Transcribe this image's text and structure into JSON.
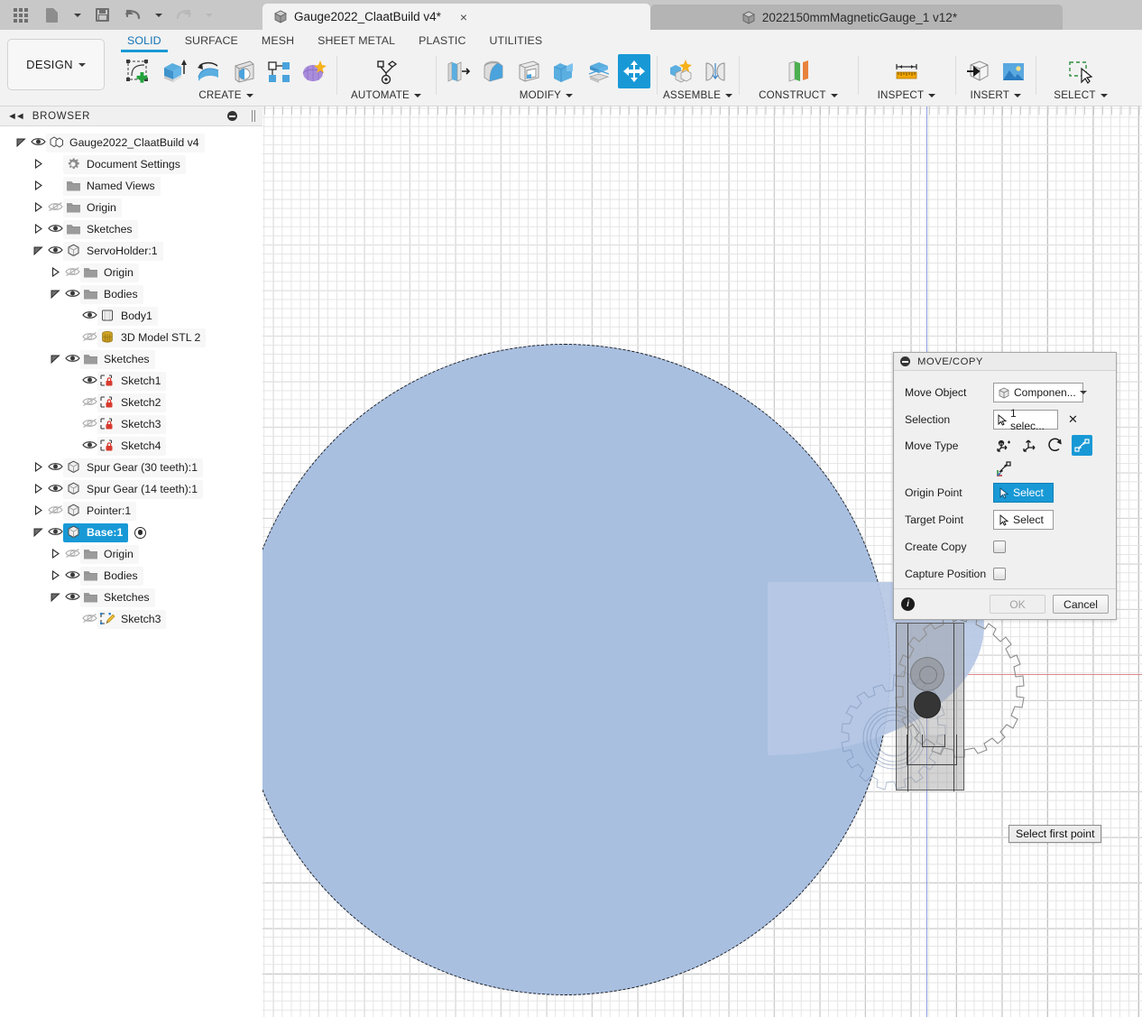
{
  "titlebar": {
    "icons": [
      "apps-grid-icon",
      "new-document-icon",
      "save-icon",
      "undo-icon",
      "redo-icon"
    ],
    "tabs": [
      {
        "label": "Gauge2022_ClaatBuild v4*",
        "active": true,
        "close": "×"
      },
      {
        "label": "2022150mmMagneticGauge_1 v12*",
        "active": false,
        "close": ""
      }
    ]
  },
  "ribbon": {
    "design_label": "DESIGN",
    "workspace_tabs": [
      {
        "label": "SOLID",
        "active": true
      },
      {
        "label": "SURFACE",
        "active": false
      },
      {
        "label": "MESH",
        "active": false
      },
      {
        "label": "SHEET METAL",
        "active": false
      },
      {
        "label": "PLASTIC",
        "active": false
      },
      {
        "label": "UTILITIES",
        "active": false
      }
    ],
    "groups": [
      {
        "name": "CREATE",
        "label": "CREATE",
        "dropdown": true
      },
      {
        "name": "AUTOMATE",
        "label": "AUTOMATE",
        "dropdown": true
      },
      {
        "name": "MODIFY",
        "label": "MODIFY",
        "dropdown": true
      },
      {
        "name": "ASSEMBLE",
        "label": "ASSEMBLE",
        "dropdown": true
      },
      {
        "name": "CONSTRUCT",
        "label": "CONSTRUCT",
        "dropdown": true
      },
      {
        "name": "INSPECT",
        "label": "INSPECT",
        "dropdown": true
      },
      {
        "name": "INSERT",
        "label": "INSERT",
        "dropdown": true
      },
      {
        "name": "SELECT",
        "label": "SELECT",
        "dropdown": true
      }
    ]
  },
  "browser": {
    "title": "BROWSER",
    "collapse_icon": "double-chevron-left-icon",
    "options_icon": "minus-circle-icon",
    "nodes": [
      {
        "label": "Gauge2022_ClaatBuild v4",
        "indent": 0,
        "twisty": "down",
        "eye": "visible",
        "icon": "assembly-icon",
        "selected": false
      },
      {
        "label": "Document Settings",
        "indent": 1,
        "twisty": "right",
        "eye": "none",
        "icon": "gear-icon",
        "selected": false
      },
      {
        "label": "Named Views",
        "indent": 1,
        "twisty": "right",
        "eye": "none",
        "icon": "folder-icon",
        "selected": false
      },
      {
        "label": "Origin",
        "indent": 1,
        "twisty": "right",
        "eye": "hidden",
        "icon": "folder-icon",
        "selected": false
      },
      {
        "label": "Sketches",
        "indent": 1,
        "twisty": "right",
        "eye": "visible",
        "icon": "folder-icon",
        "selected": false
      },
      {
        "label": "ServoHolder:1",
        "indent": 1,
        "twisty": "down",
        "eye": "visible",
        "icon": "component-icon",
        "selected": false
      },
      {
        "label": "Origin",
        "indent": 2,
        "twisty": "right",
        "eye": "hidden",
        "icon": "folder-icon",
        "selected": false
      },
      {
        "label": "Bodies",
        "indent": 2,
        "twisty": "down",
        "eye": "visible",
        "icon": "folder-icon",
        "selected": false
      },
      {
        "label": "Body1",
        "indent": 3,
        "twisty": "none",
        "eye": "visible",
        "icon": "body-icon",
        "selected": false
      },
      {
        "label": "3D Model STL 2",
        "indent": 3,
        "twisty": "none",
        "eye": "hidden",
        "icon": "mesh-body-icon",
        "selected": false
      },
      {
        "label": "Sketches",
        "indent": 2,
        "twisty": "down",
        "eye": "visible",
        "icon": "folder-icon",
        "selected": false
      },
      {
        "label": "Sketch1",
        "indent": 3,
        "twisty": "none",
        "eye": "visible",
        "icon": "sketch-locked-icon",
        "selected": false
      },
      {
        "label": "Sketch2",
        "indent": 3,
        "twisty": "none",
        "eye": "hidden",
        "icon": "sketch-locked-icon",
        "selected": false
      },
      {
        "label": "Sketch3",
        "indent": 3,
        "twisty": "none",
        "eye": "hidden",
        "icon": "sketch-locked-icon",
        "selected": false
      },
      {
        "label": "Sketch4",
        "indent": 3,
        "twisty": "none",
        "eye": "visible",
        "icon": "sketch-locked-icon",
        "selected": false
      },
      {
        "label": "Spur Gear (30 teeth):1",
        "indent": 1,
        "twisty": "right",
        "eye": "visible",
        "icon": "component-icon",
        "selected": false
      },
      {
        "label": "Spur Gear (14 teeth):1",
        "indent": 1,
        "twisty": "right",
        "eye": "visible",
        "icon": "component-icon",
        "selected": false
      },
      {
        "label": "Pointer:1",
        "indent": 1,
        "twisty": "right",
        "eye": "hidden",
        "icon": "component-icon",
        "selected": false
      },
      {
        "label": "Base:1",
        "indent": 1,
        "twisty": "down",
        "eye": "visible",
        "icon": "component-icon",
        "selected": true,
        "activated": true
      },
      {
        "label": "Origin",
        "indent": 2,
        "twisty": "right",
        "eye": "hidden",
        "icon": "folder-icon",
        "selected": false
      },
      {
        "label": "Bodies",
        "indent": 2,
        "twisty": "right",
        "eye": "visible",
        "icon": "folder-icon",
        "selected": false
      },
      {
        "label": "Sketches",
        "indent": 2,
        "twisty": "down",
        "eye": "visible",
        "icon": "folder-icon",
        "selected": false
      },
      {
        "label": "Sketch3",
        "indent": 3,
        "twisty": "none",
        "eye": "hidden",
        "icon": "sketch-edit-icon",
        "selected": false
      }
    ]
  },
  "dialog": {
    "title": "MOVE/COPY",
    "collapse_icon": "minus-circle-icon",
    "move_object": {
      "label": "Move Object",
      "value": "Componen...",
      "icon": "component-icon"
    },
    "selection": {
      "label": "Selection",
      "value": "1 selec...",
      "icon": "cursor-icon",
      "clear": "✕"
    },
    "move_type": {
      "label": "Move Type",
      "options": [
        "free-move-icon",
        "translate-icon",
        "rotate-icon",
        "point-to-point-icon",
        "align-icon"
      ],
      "selected_index": 3
    },
    "origin_point": {
      "label": "Origin Point",
      "button": "Select",
      "active": true
    },
    "target_point": {
      "label": "Target Point",
      "button": "Select",
      "active": false
    },
    "create_copy": {
      "label": "Create Copy",
      "checked": false
    },
    "capture_position": {
      "label": "Capture Position",
      "checked": false
    },
    "footer": {
      "info_icon": "info-icon",
      "ok": "OK",
      "ok_enabled": false,
      "cancel": "Cancel"
    }
  },
  "canvas": {
    "tooltip": "Select first point",
    "colors": {
      "body_fill": "#a9bfe0",
      "axis_x": "#e08a8a",
      "axis_y": "#8a9ce0",
      "accent": "#1899d6"
    },
    "objects": [
      "base-disc",
      "spur-gear-30",
      "spur-gear-14-ghost",
      "servo-holder-body"
    ]
  }
}
